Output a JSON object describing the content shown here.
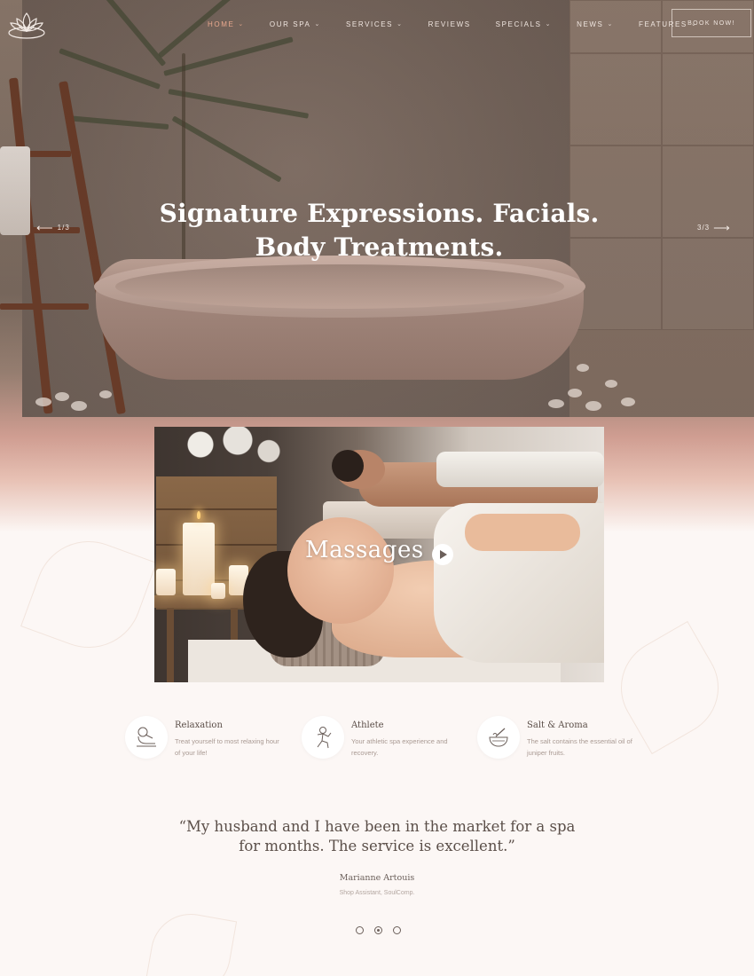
{
  "nav": {
    "items": [
      {
        "label": "HOME",
        "has_dropdown": true,
        "active": true
      },
      {
        "label": "OUR SPA",
        "has_dropdown": true,
        "active": false
      },
      {
        "label": "SERVICES",
        "has_dropdown": true,
        "active": false
      },
      {
        "label": "REVIEWS",
        "has_dropdown": false,
        "active": false
      },
      {
        "label": "SPECIALS",
        "has_dropdown": true,
        "active": false
      },
      {
        "label": "NEWS",
        "has_dropdown": true,
        "active": false
      },
      {
        "label": "FEATURES",
        "has_dropdown": true,
        "active": false
      }
    ],
    "book_button": "BOOK NOW!"
  },
  "hero": {
    "title_line1": "Signature Expressions. Facials.",
    "title_line2": "Body Treatments.",
    "prev_counter": "1/3",
    "next_counter": "3/3"
  },
  "video": {
    "label": "Massages"
  },
  "features": [
    {
      "icon": "relaxation-icon",
      "title": "Relaxation",
      "text": "Treat yourself to most relaxing hour of your life!"
    },
    {
      "icon": "athlete-icon",
      "title": "Athlete",
      "text": "Your athletic spa experience and recovery."
    },
    {
      "icon": "salt-aroma-icon",
      "title": "Salt & Aroma",
      "text": "The salt contains the essential oil of juniper fruits."
    }
  ],
  "testimonial": {
    "quote_line1": "“My husband and I have been in the market for a spa",
    "quote_line2": "for months. The service is excellent.”",
    "author": "Marianne Artouis",
    "role": "Shop Assistant, SoulComp."
  },
  "colors": {
    "accent": "#e9a98e",
    "text": "#5b4f49",
    "background": "#fcf7f5"
  }
}
